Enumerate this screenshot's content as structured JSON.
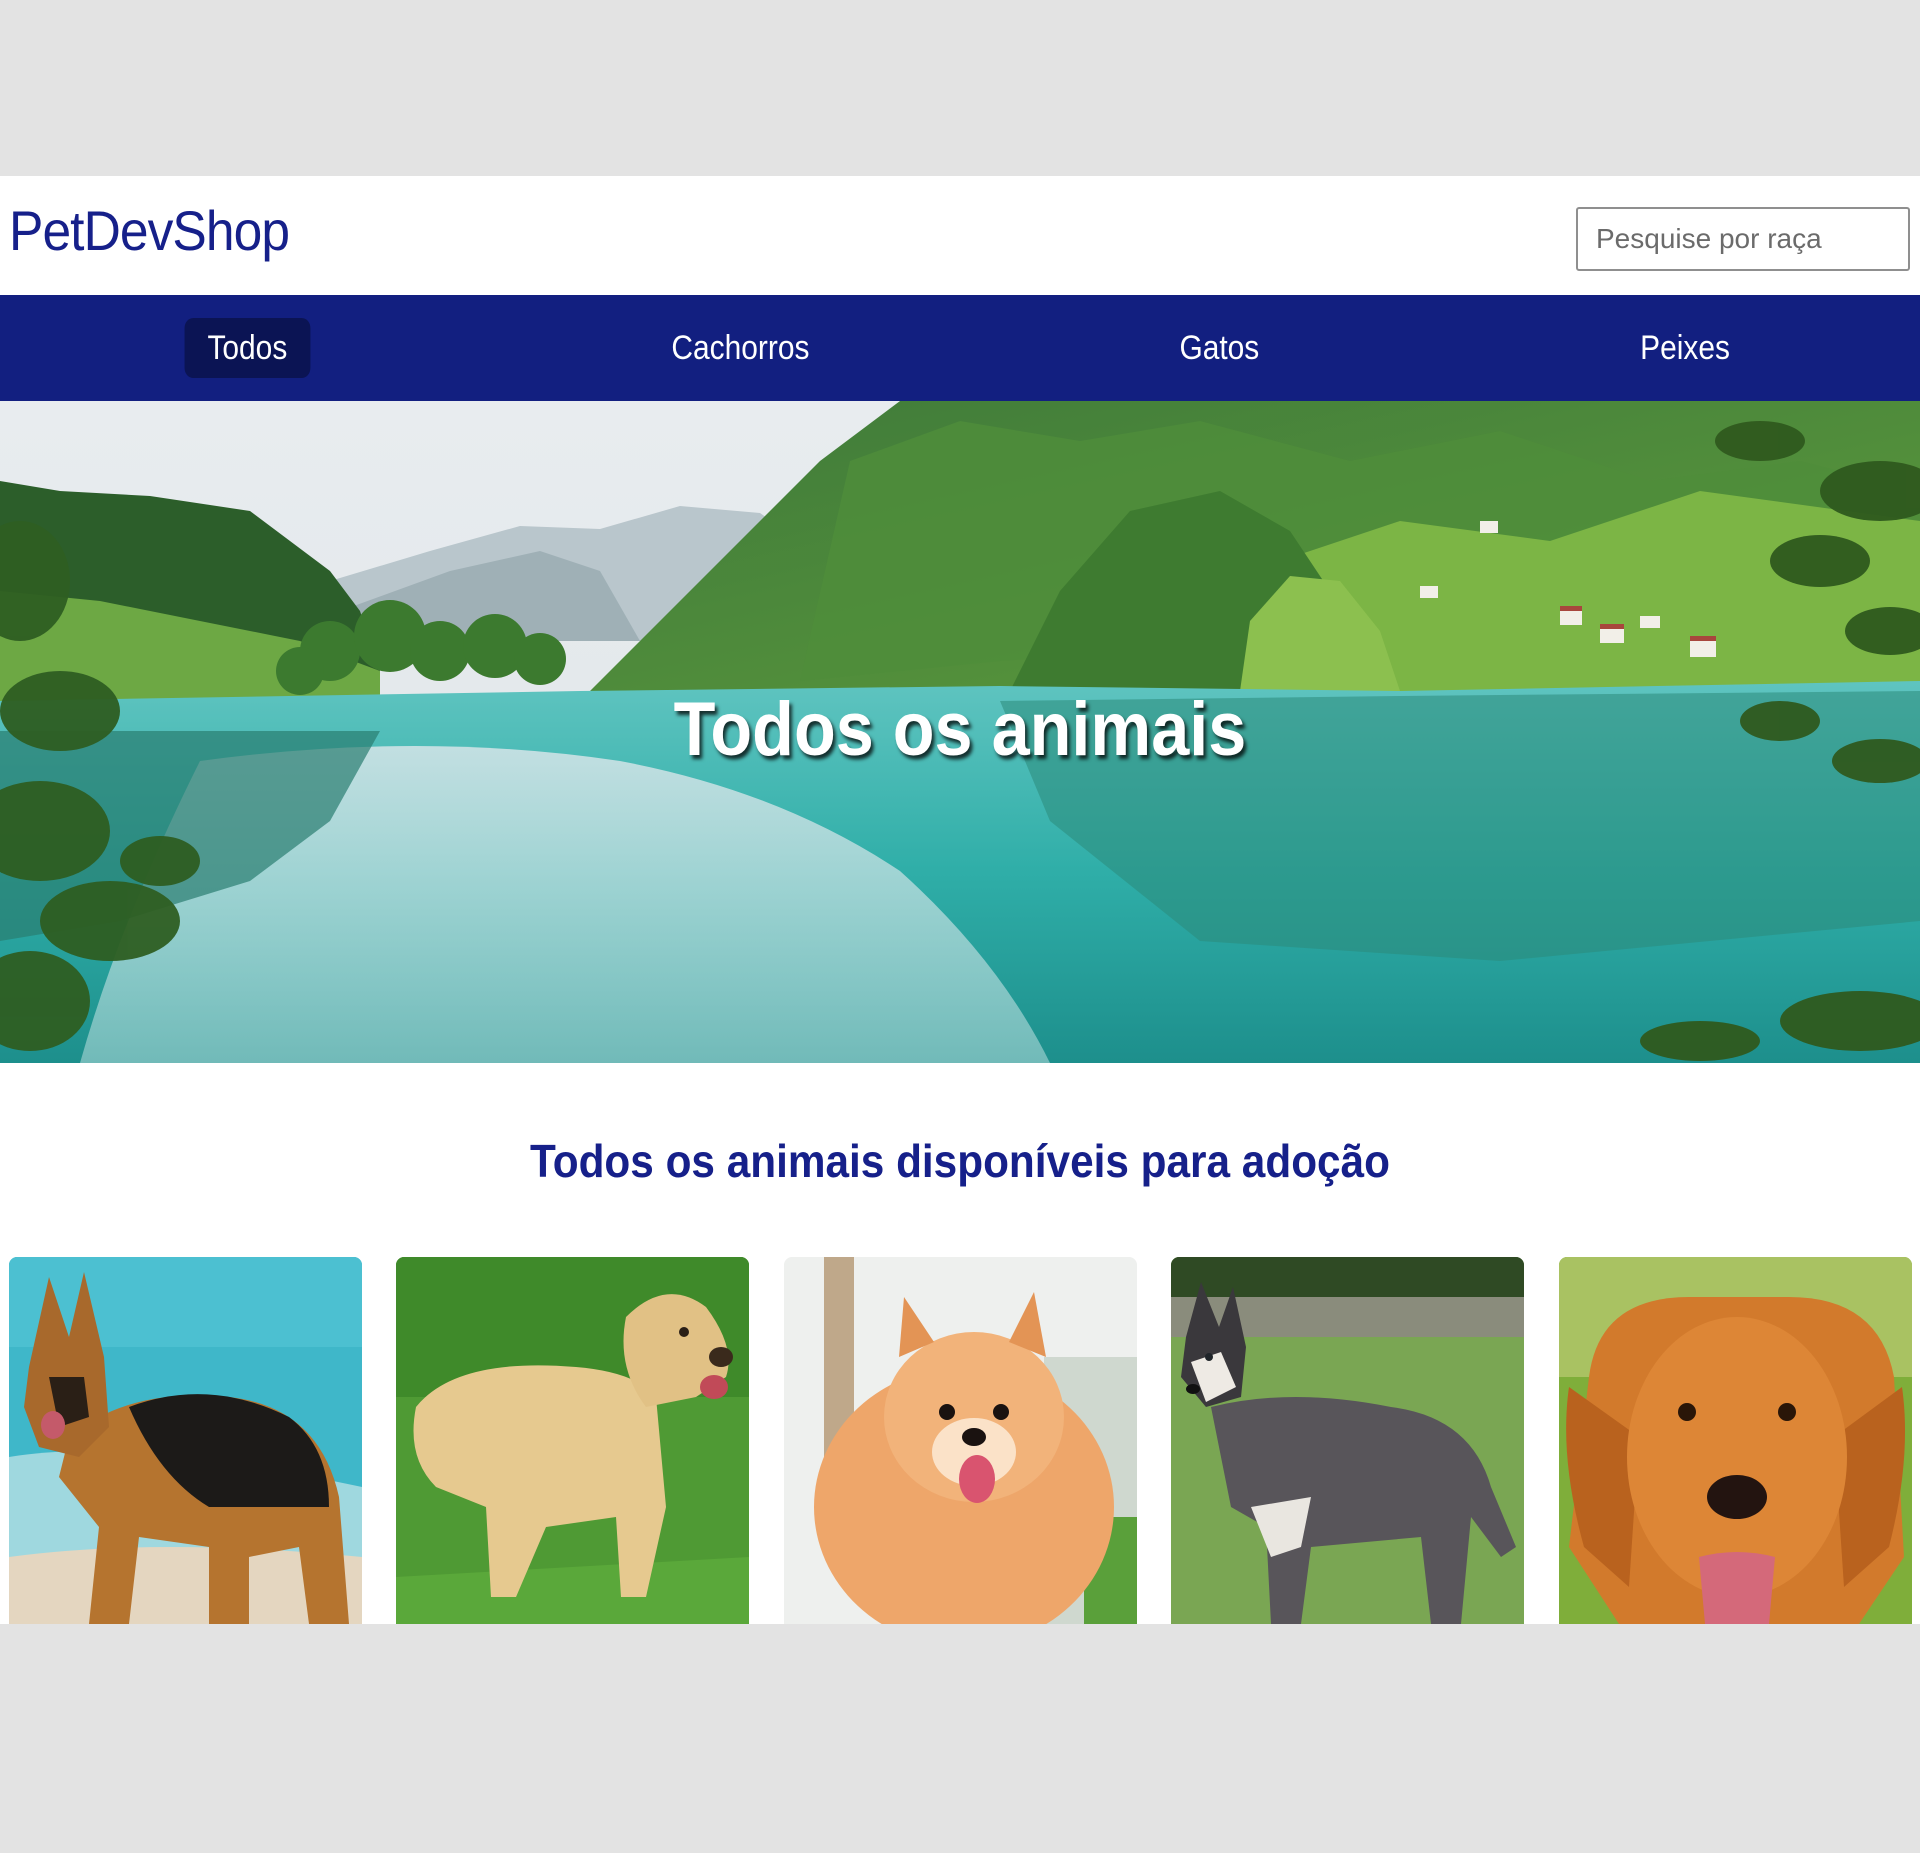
{
  "header": {
    "logo": "PetDevShop",
    "search": {
      "placeholder": "Pesquise por raça",
      "value": ""
    }
  },
  "nav": {
    "items": [
      {
        "label": "Todos",
        "active": true
      },
      {
        "label": "Cachorros",
        "active": false
      },
      {
        "label": "Gatos",
        "active": false
      },
      {
        "label": "Peixes",
        "active": false
      }
    ]
  },
  "hero": {
    "title": "Todos os animais"
  },
  "section": {
    "title": "Todos os animais disponíveis para adoção"
  },
  "colors": {
    "brand": "#16208a",
    "nav_background": "#121f80",
    "nav_active": "#0b1454",
    "page_background": "#e3e3e3"
  }
}
